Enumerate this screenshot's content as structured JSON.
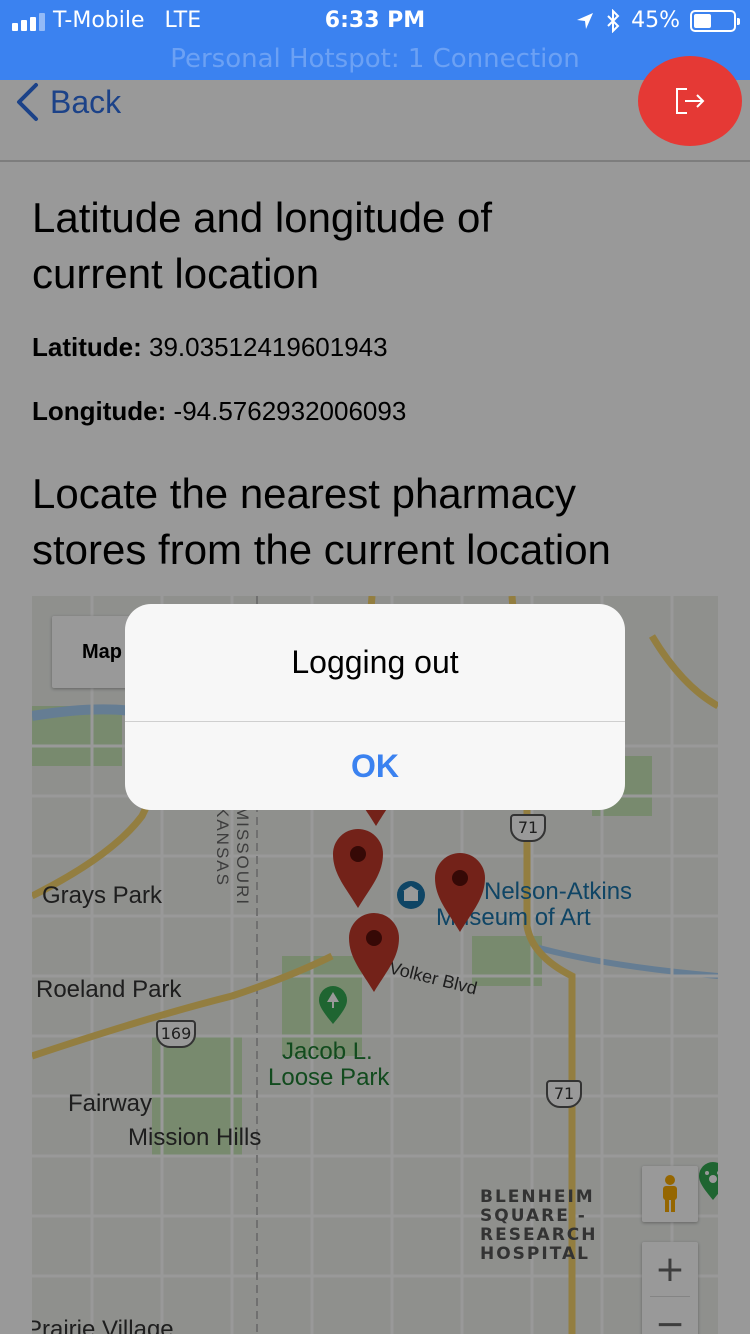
{
  "status_bar": {
    "carrier": "T-Mobile",
    "network": "LTE",
    "time": "6:33 PM",
    "battery": "45%",
    "battery_level": 0.45,
    "hotspot": "Personal Hotspot: 1 Connection"
  },
  "nav": {
    "back_label": "Back"
  },
  "content": {
    "heading_location_line1": "Latitude and longitude of",
    "heading_location_line2": "current location",
    "latitude_label": "Latitude:",
    "latitude_value": "39.03512419601943",
    "longitude_label": "Longitude:",
    "longitude_value": "-94.5762932006093",
    "heading_pharmacy_line1": "Locate the nearest pharmacy",
    "heading_pharmacy_line2": "stores from the current location"
  },
  "map": {
    "type_button": "Map",
    "labels": {
      "grays_park": "Grays Park",
      "roeland_park": "Roeland Park",
      "fairway": "Fairway",
      "mission_hills": "Mission Hills",
      "prairie_village": "Prairie Village",
      "jacob_loose_1": "Jacob L.",
      "jacob_loose_2": "Loose Park",
      "nelson_atkins_1": "Nelson-Atkins",
      "nelson_atkins_2": "Museum of Art",
      "volker": "Volker Blvd",
      "missouri": "MISSOURI",
      "kansas": "KANSAS",
      "hospital_1": "BLENHEIM",
      "hospital_2": "SQUARE -",
      "hospital_3": "RESEARCH",
      "hospital_4": "HOSPITAL"
    },
    "route_shields": {
      "r71_a": "71",
      "r71_b": "71",
      "r169": "169"
    },
    "zoom_in": "+",
    "zoom_out": "−",
    "colors": {
      "pin": "#c0392b",
      "highway": "#f6d36b",
      "park": "#c8e6b8",
      "water": "#a9d0f5"
    }
  },
  "alert": {
    "title": "Logging out",
    "ok_label": "OK"
  },
  "colors": {
    "status_bar_bg": "#3b82f0",
    "accent": "#2f6fe3",
    "logout_button": "#e53935"
  }
}
